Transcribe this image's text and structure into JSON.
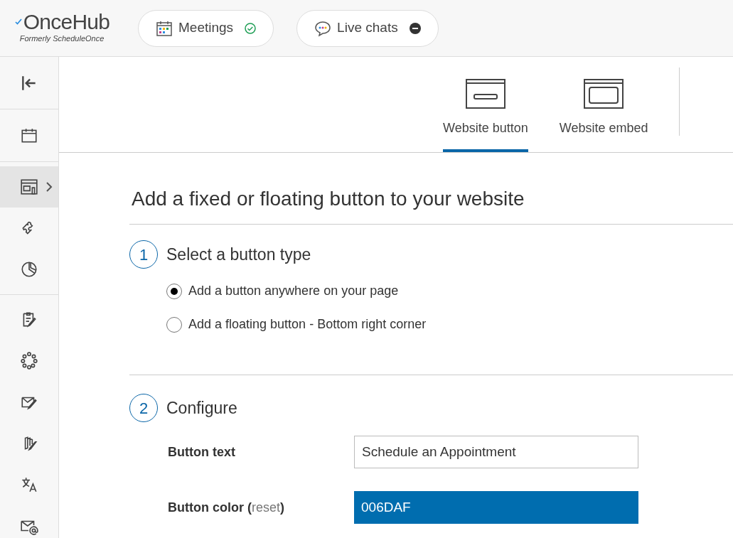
{
  "header": {
    "logo": "OnceHub",
    "tagline": "Formerly ScheduleOnce",
    "products": [
      {
        "label": "Meetings",
        "active": true
      },
      {
        "label": "Live chats",
        "active": false
      }
    ]
  },
  "sidebar": {
    "groups": [
      [
        {
          "selected": false
        }
      ],
      [
        {
          "selected": false
        }
      ],
      [
        {
          "selected": true
        },
        {
          "selected": false
        },
        {
          "selected": false
        }
      ],
      [
        {
          "selected": false
        },
        {
          "selected": false
        },
        {
          "selected": false
        },
        {
          "selected": false
        },
        {
          "selected": false
        },
        {
          "selected": false
        }
      ]
    ]
  },
  "tabs": [
    {
      "label": "Website button",
      "selected": true
    },
    {
      "label": "Website embed",
      "selected": false
    }
  ],
  "title": "Add a fixed or floating button to your website",
  "steps": [
    {
      "number": "1",
      "title": "Select a button type",
      "options": [
        {
          "label": "Add a button anywhere on your page",
          "selected": true
        },
        {
          "label": "Add a floating button - Bottom right corner",
          "selected": false
        }
      ]
    },
    {
      "number": "2",
      "title": "Configure",
      "fields": [
        {
          "label": "Button text",
          "value": "Schedule an Appointment",
          "kind": "text"
        },
        {
          "label": "Button color",
          "link_open": "(",
          "link": "reset",
          "link_close": ")",
          "value": "006DAF",
          "kind": "color"
        }
      ]
    }
  ]
}
